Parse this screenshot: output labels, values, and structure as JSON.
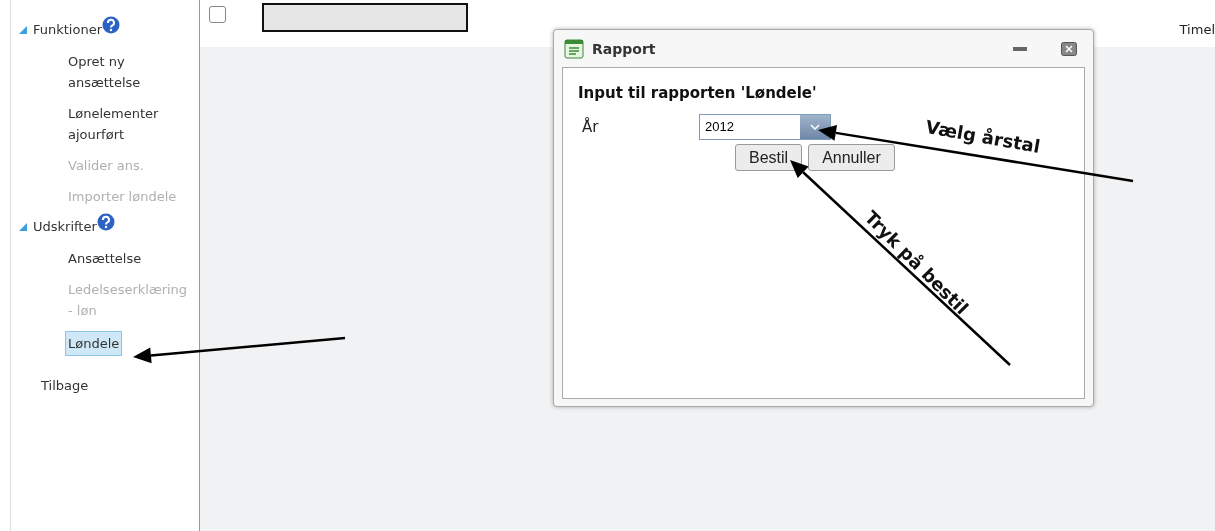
{
  "sidebar": {
    "sections": [
      {
        "title": "Funktioner",
        "expanded": true,
        "items": [
          {
            "label": "Opret ny ansættelse",
            "disabled": false,
            "selected": false
          },
          {
            "label": "Lønelementer ajourført",
            "disabled": false,
            "selected": false
          },
          {
            "label": "Valider ans.",
            "disabled": true,
            "selected": false
          },
          {
            "label": "Importer løndele",
            "disabled": true,
            "selected": false
          }
        ]
      },
      {
        "title": "Udskrifter",
        "expanded": true,
        "items": [
          {
            "label": "Ansættelse",
            "disabled": false,
            "selected": false
          },
          {
            "label": "Ledelseserklæring - løn",
            "disabled": true,
            "selected": false
          },
          {
            "label": "Løndele",
            "disabled": false,
            "selected": true
          }
        ]
      }
    ],
    "back": "Tilbage"
  },
  "table": {
    "row": {
      "checked": false,
      "column_last": "Timel"
    }
  },
  "dialog": {
    "title": "Rapport",
    "heading": "Input til rapporten 'Løndele'",
    "field_label": "År",
    "year": "2012",
    "buttons": [
      "Bestil",
      "Annuller"
    ]
  },
  "annotations": [
    {
      "text": "Vælg årstal"
    },
    {
      "text": "Tryk på bestil"
    }
  ]
}
